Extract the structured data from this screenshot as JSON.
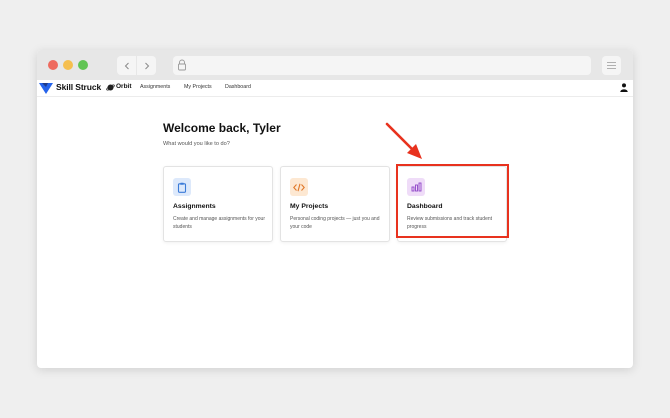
{
  "app": {
    "brand": "Skill Struck",
    "product": "Orbit"
  },
  "nav": {
    "links": [
      "Assignments",
      "My Projects",
      "Dashboard"
    ]
  },
  "main": {
    "welcome": "Welcome back, Tyler",
    "subtitle": "What would you like to do?"
  },
  "cards": [
    {
      "title": "Assignments",
      "description": "Create and manage assignments for your students",
      "icon": "clipboard-icon",
      "icon_color": "#3b7bd8",
      "icon_bg": "#dde9fb"
    },
    {
      "title": "My Projects",
      "description": "Personal coding projects — just you and your code",
      "icon": "code-icon",
      "icon_color": "#e0782a",
      "icon_bg": "#fde8d2"
    },
    {
      "title": "Dashboard",
      "description": "Review submissions and track student progress",
      "icon": "bar-chart-icon",
      "icon_color": "#8e44c7",
      "icon_bg": "#efdcf8"
    }
  ],
  "colors": {
    "highlight": "#e8321e",
    "brand_blue": "#2563eb"
  }
}
